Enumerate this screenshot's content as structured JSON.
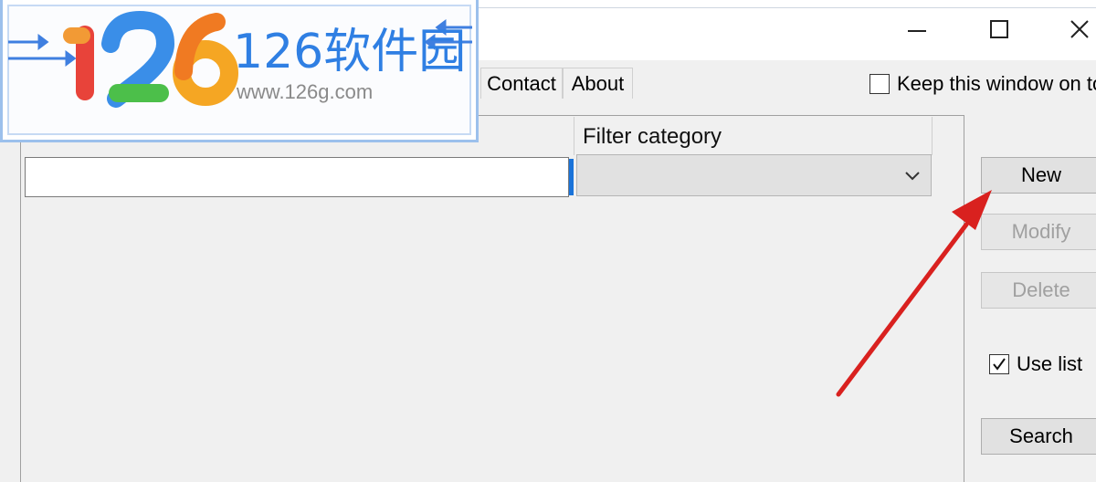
{
  "window": {
    "controls": {
      "minimize_icon": "minimize-icon",
      "maximize_icon": "maximize-icon",
      "close_icon": "close-icon"
    }
  },
  "tabs": [
    {
      "label": "Contact"
    },
    {
      "label": "About"
    }
  ],
  "keep_on_top": {
    "label": "Keep this window on to",
    "checked": false
  },
  "filter": {
    "header": "Filter category",
    "keyword_value": "",
    "selected": ""
  },
  "side_buttons": {
    "new_label": "New",
    "modify_label": "Modify",
    "delete_label": "Delete",
    "use_list_label": "Use list",
    "use_list_checked": true,
    "search_label": "Search"
  },
  "watermark": {
    "logo_text": "126软件园",
    "url": "www.126g.com"
  },
  "colors": {
    "annotation_arrow": "#d9211f",
    "focus_accent": "#1a73d9",
    "watermark_border": "#9cc0ec"
  }
}
